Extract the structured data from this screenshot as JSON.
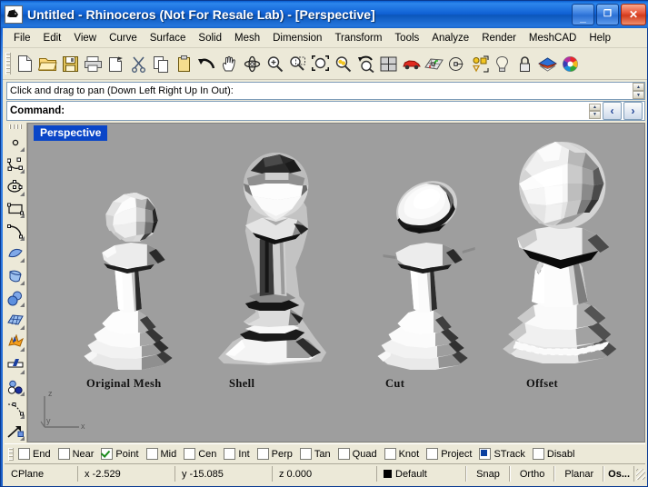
{
  "window": {
    "title": "Untitled - Rhinoceros (Not For Resale Lab) - [Perspective]",
    "icon": "rhino-icon",
    "minimize_label": "_",
    "maximize_label": "❐",
    "close_label": "✕",
    "accent_color": "#0a5fd0",
    "close_color": "#d23b1d"
  },
  "menubar": {
    "items": [
      {
        "label": "File"
      },
      {
        "label": "Edit"
      },
      {
        "label": "View"
      },
      {
        "label": "Curve"
      },
      {
        "label": "Surface"
      },
      {
        "label": "Solid"
      },
      {
        "label": "Mesh"
      },
      {
        "label": "Dimension"
      },
      {
        "label": "Transform"
      },
      {
        "label": "Tools"
      },
      {
        "label": "Analyze"
      },
      {
        "label": "Render"
      },
      {
        "label": "MeshCAD"
      },
      {
        "label": "Help"
      }
    ]
  },
  "toolbar": {
    "buttons": [
      {
        "name": "new-file-icon"
      },
      {
        "name": "open-folder-icon"
      },
      {
        "name": "save-icon"
      },
      {
        "name": "print-icon"
      },
      {
        "name": "print-preview-icon"
      },
      {
        "name": "cut-scissors-icon"
      },
      {
        "name": "copy-icon"
      },
      {
        "name": "paste-icon"
      },
      {
        "name": "undo-icon"
      },
      {
        "name": "pan-hand-icon"
      },
      {
        "name": "rotate-view-icon"
      },
      {
        "name": "zoom-in-icon"
      },
      {
        "name": "zoom-window-icon"
      },
      {
        "name": "zoom-extents-icon"
      },
      {
        "name": "zoom-selected-icon"
      },
      {
        "name": "zoom-previous-icon"
      },
      {
        "name": "viewport-layout-icon"
      },
      {
        "name": "render-car-icon"
      },
      {
        "name": "render-mesh-icon"
      },
      {
        "name": "shaded-view-icon"
      },
      {
        "name": "select-objects-icon"
      },
      {
        "name": "light-bulb-icon"
      },
      {
        "name": "lock-icon"
      },
      {
        "name": "layers-icon"
      },
      {
        "name": "color-wheel-icon"
      }
    ]
  },
  "command": {
    "history": "Click and drag to pan (Down Left Right Up In Out):",
    "prompt": "Command:",
    "prev_label": "‹",
    "next_label": "›"
  },
  "sidebar": {
    "items": [
      {
        "name": "point-tool"
      },
      {
        "name": "control-point-curve-tool"
      },
      {
        "name": "ellipse-tool"
      },
      {
        "name": "rectangle-tool"
      },
      {
        "name": "arc-tool"
      },
      {
        "name": "surface-from-curve-tool"
      },
      {
        "name": "extrude-surface-tool"
      },
      {
        "name": "sphere-boolean-tool"
      },
      {
        "name": "mesh-surface-tool"
      },
      {
        "name": "explode-tool"
      },
      {
        "name": "trim-tool"
      },
      {
        "name": "boolean-union-tool"
      },
      {
        "name": "blend-curve-tool"
      },
      {
        "name": "transform-tool"
      }
    ]
  },
  "viewport": {
    "label": "Perspective",
    "background_color": "#9e9e9e",
    "label_bg_color": "#0a46c8",
    "axis_gizmo": {
      "x": "x",
      "y": "y",
      "z": "z"
    },
    "models": [
      {
        "label": "Original Mesh"
      },
      {
        "label": "Shell"
      },
      {
        "label": "Cut"
      },
      {
        "label": "Offset"
      }
    ]
  },
  "osnap": {
    "items": [
      {
        "label": "End",
        "state": "off"
      },
      {
        "label": "Near",
        "state": "off"
      },
      {
        "label": "Point",
        "state": "checked"
      },
      {
        "label": "Mid",
        "state": "off"
      },
      {
        "label": "Cen",
        "state": "off"
      },
      {
        "label": "Int",
        "state": "off"
      },
      {
        "label": "Perp",
        "state": "off"
      },
      {
        "label": "Tan",
        "state": "off"
      },
      {
        "label": "Quad",
        "state": "off"
      },
      {
        "label": "Knot",
        "state": "off"
      },
      {
        "label": "Project",
        "state": "off"
      },
      {
        "label": "STrack",
        "state": "filled"
      },
      {
        "label": "Disabl",
        "state": "off"
      }
    ]
  },
  "statusbar": {
    "cplane": "CPlane",
    "x": "x -2.529",
    "y": "y -15.085",
    "z": "z 0.000",
    "layer": "Default",
    "layer_color": "#000000",
    "toggles": [
      {
        "label": "Snap",
        "bold": false
      },
      {
        "label": "Ortho",
        "bold": false
      },
      {
        "label": "Planar",
        "bold": false
      },
      {
        "label": "Os...",
        "bold": true
      }
    ]
  }
}
